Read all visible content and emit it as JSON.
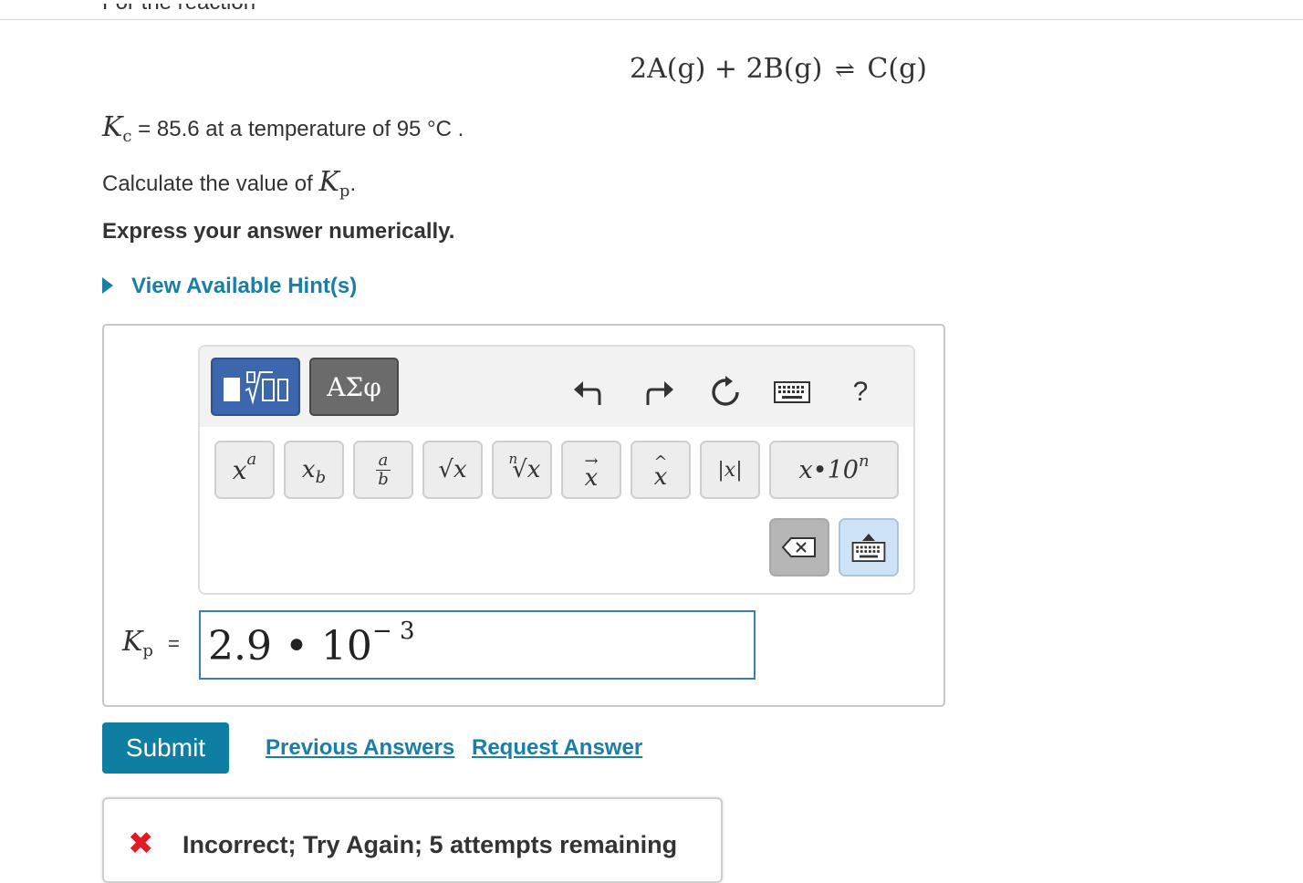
{
  "problem": {
    "intro_cut": "For the reaction",
    "equation": {
      "left": "2A(g) + 2B(g)",
      "arrow": "⇌",
      "right": "C(g)"
    },
    "kc_symbol": "K",
    "kc_sub": "c",
    "kc_text": " = 85.6 at a temperature of 95  °C .",
    "calc_prefix": "Calculate the value of ",
    "kp_symbol": "K",
    "kp_sub": "p",
    "calc_suffix": ".",
    "express": "Express your answer numerically.",
    "hint_label": "View Available Hint(s)"
  },
  "toolbar": {
    "symbols_tab": "ΑΣφ",
    "help": "?",
    "keys": {
      "power_base": "x",
      "power_exp": "a",
      "subscript_base": "x",
      "subscript_sub": "b",
      "frac_num": "a",
      "frac_den": "b",
      "sqrt": "√x",
      "nroot_n": "n",
      "nroot": "√x",
      "vector_arrow": "→",
      "vector_var": "x",
      "hat_mark": "^",
      "hat_var": "x",
      "abs": "|x|",
      "sci": "x•10",
      "sci_exp": "n"
    }
  },
  "answer": {
    "label_symbol": "K",
    "label_sub": "p",
    "label_eq": "=",
    "value": "2.9 • 10",
    "exponent": "− 3"
  },
  "actions": {
    "submit": "Submit",
    "previous": "Previous Answers",
    "request": "Request Answer"
  },
  "feedback": {
    "icon": "✖",
    "message": "Incorrect; Try Again; 5 attempts remaining"
  },
  "colors": {
    "accent": "#0f7ea3",
    "link": "#1a7ea6",
    "error": "#e01b24",
    "tab_active": "#3c67ad",
    "tab_inactive": "#6b6b6b"
  }
}
